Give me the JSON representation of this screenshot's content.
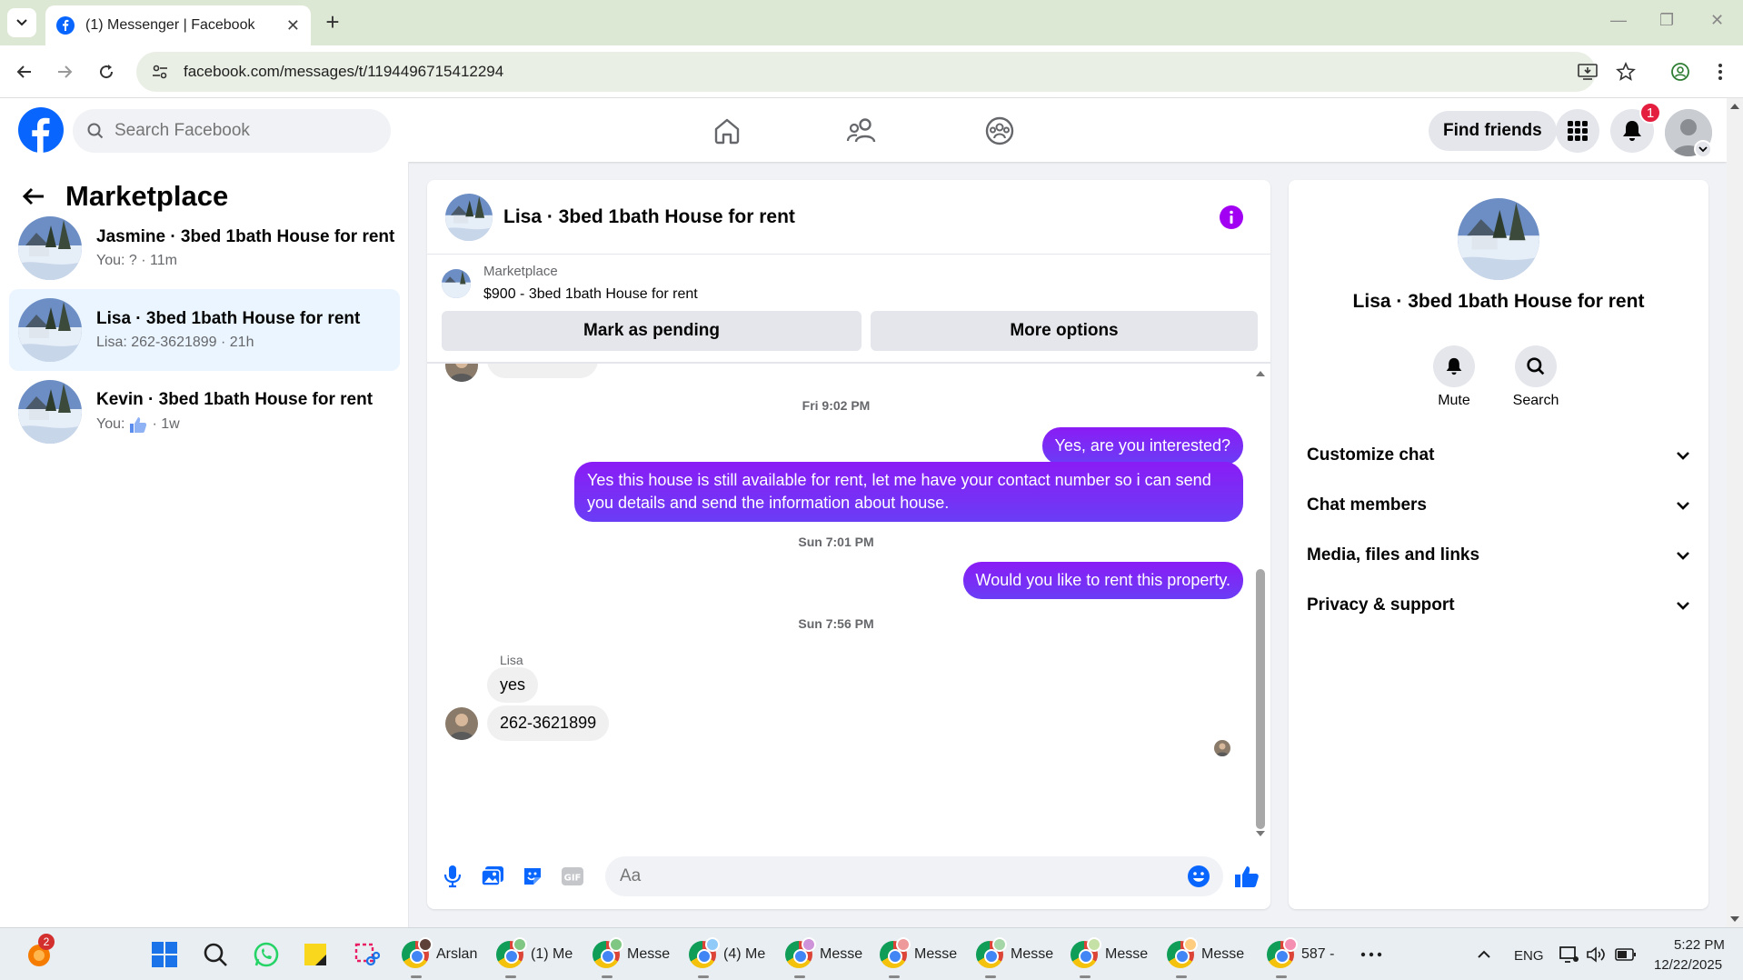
{
  "browser": {
    "tab_title": "(1) Messenger | Facebook",
    "url": "facebook.com/messages/t/1194496715412294"
  },
  "fb_header": {
    "search_placeholder": "Search Facebook",
    "find_friends_label": "Find friends",
    "notification_count": "1"
  },
  "left_panel": {
    "title": "Marketplace",
    "conversations": [
      {
        "name": "Jasmine · 3bed 1bath House for rent",
        "preview": "You: ? · 11m",
        "active": false
      },
      {
        "name": "Lisa · 3bed 1bath House for rent",
        "preview": "Lisa: 262-3621899 · 21h",
        "active": true
      },
      {
        "name": "Kevin · 3bed 1bath House for rent",
        "preview_prefix": "You:",
        "preview_icon": "thumbs-up-icon",
        "preview_suffix": "· 1w",
        "active": false
      }
    ]
  },
  "chat": {
    "title": "Lisa · 3bed 1bath House for rent",
    "marketplace_label": "Marketplace",
    "listing": "$900 - 3bed 1bath House for rent",
    "mark_pending_label": "Mark as pending",
    "more_options_label": "More options",
    "timestamps": [
      "Fri 9:02 PM",
      "Sun 7:01 PM",
      "Sun 7:56 PM"
    ],
    "messages": [
      {
        "from": "me",
        "text": "Yes, are you interested?"
      },
      {
        "from": "me",
        "text": "Yes this house is still available for rent, let me have your contact number so i can send you details and send the information about house."
      },
      {
        "from": "me",
        "text": "Would you like to rent this property."
      },
      {
        "from": "Lisa",
        "text": "yes"
      },
      {
        "from": "Lisa",
        "text": "262-3621899"
      }
    ],
    "sender_label": "Lisa",
    "input_placeholder": "Aa"
  },
  "right_panel": {
    "name": "Lisa · 3bed 1bath House for rent",
    "mute_label": "Mute",
    "search_label": "Search",
    "sections": [
      "Customize chat",
      "Chat members",
      "Media, files and links",
      "Privacy & support"
    ]
  },
  "taskbar": {
    "badge_count": "2",
    "apps": [
      "Arslan",
      "(1) Me",
      "Messe",
      "(4) Me",
      "Messe",
      "Messe",
      "Messe",
      "Messe",
      "Messe",
      "587 -"
    ],
    "language": "ENG",
    "time": "5:22 PM",
    "date": "12/22/2025"
  },
  "colors": {
    "fb_blue": "#0866ff",
    "bubble_purple": "#7a2ff7",
    "info_purple": "#a100f2",
    "active_conv_bg": "#ebf5ff"
  }
}
